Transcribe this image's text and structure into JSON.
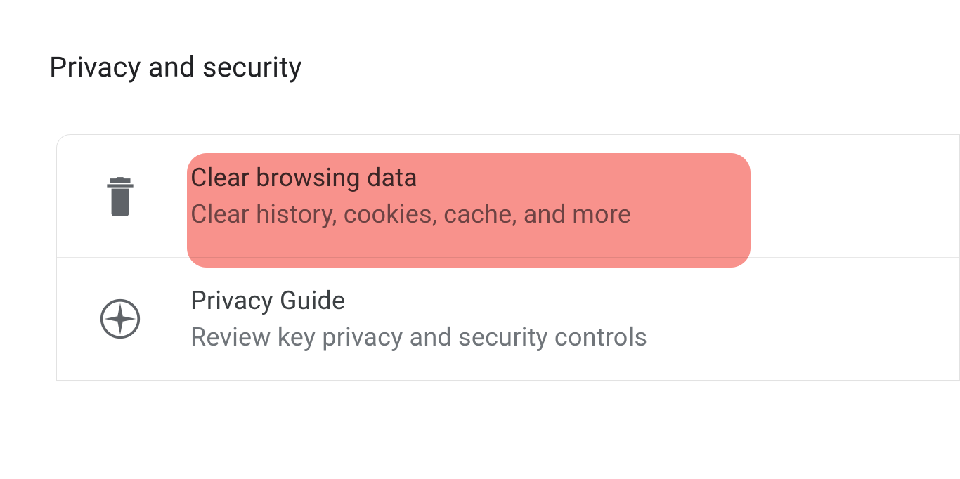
{
  "section": {
    "title": "Privacy and security"
  },
  "rows": [
    {
      "title": "Clear browsing data",
      "subtitle": "Clear history, cookies, cache, and more",
      "highlighted": true
    },
    {
      "title": "Privacy Guide",
      "subtitle": "Review key privacy and security controls",
      "highlighted": false
    }
  ]
}
